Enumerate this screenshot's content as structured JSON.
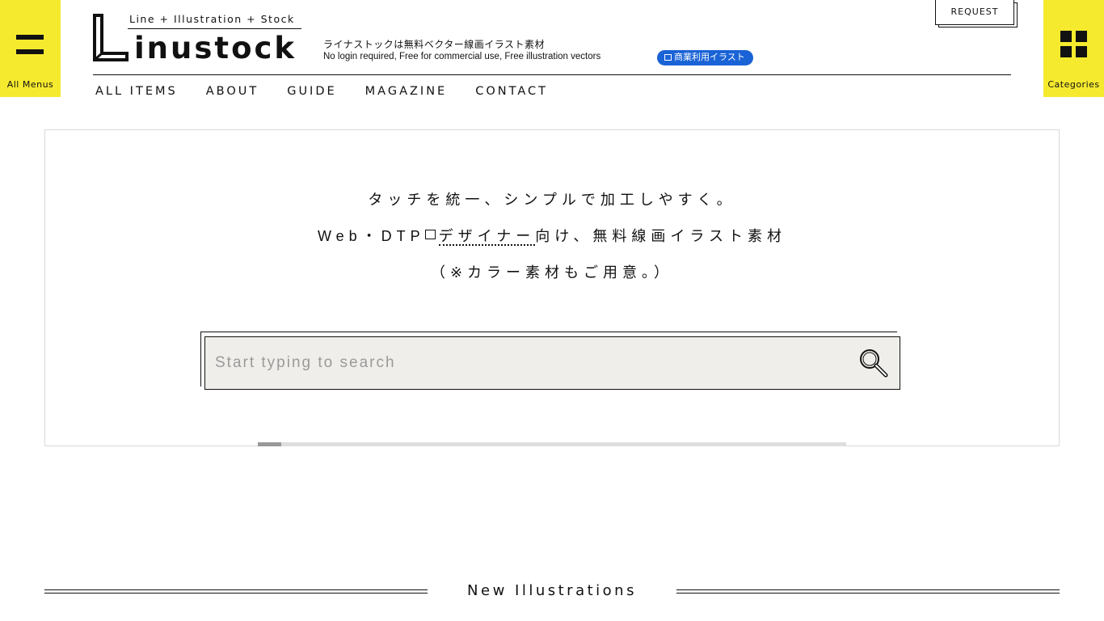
{
  "header": {
    "menu_label": "All Menus",
    "categories_label": "Categories",
    "request_label": "REQUEST",
    "logo": {
      "tagline": "Line + Illustration + Stock",
      "wordmark": "inustock"
    },
    "tagline_jp": "ライナストックは無料ベクター線画イラスト素材",
    "tagline_en": "No login required, Free for commercial use, Free illustration vectors",
    "commercial_badge": "商業利用イラスト"
  },
  "nav": {
    "items": [
      "ALL ITEMS",
      "ABOUT",
      "GUIDE",
      "MAGAZINE",
      "CONTACT"
    ]
  },
  "hero": {
    "line1": "タッチを統一、シンプルで加工しやすく。",
    "line2_prefix": "Web・DTP",
    "line2_link": "デザイナー",
    "line2_suffix": "向け、無料線画イラスト素材",
    "line3": "（※カラー素材もご用意。）"
  },
  "search": {
    "placeholder": "Start typing to search",
    "value": ""
  },
  "progress": {
    "fraction": 0.04
  },
  "sections": {
    "new_title": "New Illustrations"
  }
}
